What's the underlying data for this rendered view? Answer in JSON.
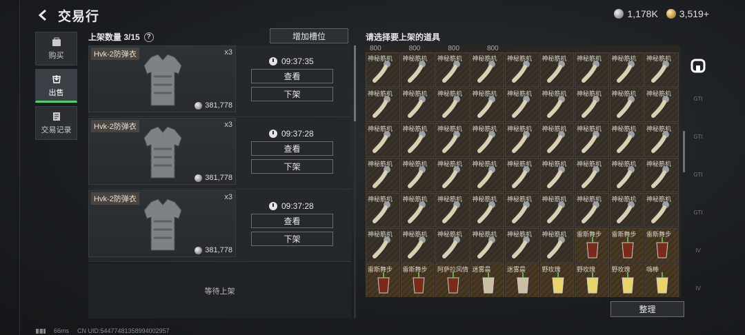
{
  "header": {
    "title": "交易行",
    "silver": "1,178K",
    "gold": "3,519+"
  },
  "nav": {
    "buy": "购买",
    "sell": "出售",
    "record": "交易记录"
  },
  "listings_panel": {
    "count_label": "上架数量 3/15",
    "help": "?",
    "add_slot": "增加槽位",
    "empty_slot": "等待上架",
    "items": [
      {
        "name": "Hvk-2防弹衣",
        "qty": "x3",
        "price": "381,778",
        "timer": "09:37:35",
        "view": "查看",
        "remove": "下架"
      },
      {
        "name": "Hvk-2防弹衣",
        "qty": "x3",
        "price": "381,778",
        "timer": "09:37:28",
        "view": "查看",
        "remove": "下架"
      },
      {
        "name": "Hvk-2防弹衣",
        "qty": "x3",
        "price": "381,778",
        "timer": "09:37:28",
        "view": "查看",
        "remove": "下架"
      }
    ]
  },
  "inventory": {
    "title": "请选择要上架的道具",
    "top_row": [
      "800",
      "800",
      "800",
      "800"
    ],
    "arrange_button": "整理",
    "cells": [
      "神秘筋机",
      "神秘筋机",
      "神秘筋机",
      "神秘筋机",
      "神秘筋机",
      "神秘筋机",
      "神秘筋机",
      "神秘筋机",
      "神秘筋机",
      "神秘筋机",
      "神秘筋机",
      "神秘筋机",
      "神秘筋机",
      "神秘筋机",
      "神秘筋机",
      "神秘筋机",
      "神秘筋机",
      "神秘筋机",
      "神秘筋机",
      "神秘筋机",
      "神秘筋机",
      "神秘筋机",
      "神秘筋机",
      "神秘筋机",
      "神秘筋机",
      "神秘筋机",
      "神秘筋机",
      "神秘筋机",
      "神秘筋机",
      "神秘筋机",
      "神秘筋机",
      "神秘筋机",
      "神秘筋机",
      "神秘筋机",
      "神秘筋机",
      "神秘筋机",
      "神秘筋机",
      "神秘筋机",
      "神秘筋机",
      "神秘筋机",
      "神秘筋机",
      "神秘筋机",
      "神秘筋机",
      "神秘筋机",
      "神秘筋机",
      "神秘筋机",
      "神秘筋机",
      "神秘筋机",
      "神秘筋机",
      "神秘筋机",
      "神秘筋机",
      "雷斯舞步",
      "雷斯舞步",
      "雷斯舞步",
      "雷斯舞步",
      "雷斯舞步",
      "阿萨拉风情",
      "迷雾晨",
      "迷雾晨",
      "野玫瑰",
      "野玫瑰",
      "野玫瑰",
      "嗨棒"
    ],
    "side_tabs": [
      "GTI",
      "GTI",
      "GTI",
      "GTI",
      "IV",
      "IV"
    ]
  },
  "status": {
    "ping": "66ms",
    "uid": "CN UID:544774813589940029​57"
  },
  "colors": {
    "accent_green": "#4fd36a",
    "panel": "#24282b"
  }
}
